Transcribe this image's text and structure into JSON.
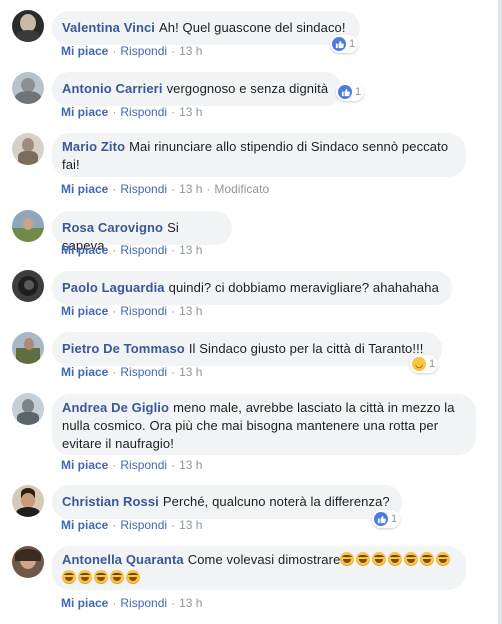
{
  "comments": [
    {
      "author": "Valentina Vinci",
      "text": "Ah! Quel guascone del sindaco!",
      "like": "Mi piace",
      "reply": "Rispondi",
      "time": "13 h",
      "reaction": {
        "type": "like",
        "count": "1"
      }
    },
    {
      "author": "Antonio Carrieri",
      "text": "vergognoso e senza dignità",
      "like": "Mi piace",
      "reply": "Rispondi",
      "time": "13 h",
      "reaction": {
        "type": "like",
        "count": "1"
      }
    },
    {
      "author": "Mario Zito",
      "text": "Mai rinunciare allo stipendio di Sindaco sennò peccato fai!",
      "like": "Mi piace",
      "reply": "Rispondi",
      "time": "13 h",
      "edited": "Modificato"
    },
    {
      "author": "Rosa Carovigno",
      "text": "Si sapeva",
      "like": "Mi piace",
      "reply": "Rispondi",
      "time": "13 h"
    },
    {
      "author": "Paolo Laguardia",
      "text": "quindi? ci dobbiamo meravigliare? ahahahaha",
      "like": "Mi piace",
      "reply": "Rispondi",
      "time": "13 h"
    },
    {
      "author": "Pietro De Tommaso",
      "text": "Il Sindaco giusto per la città di Taranto!!!",
      "like": "Mi piace",
      "reply": "Rispondi",
      "time": "13 h",
      "reaction": {
        "type": "haha",
        "count": "1"
      }
    },
    {
      "author": "Andrea De Giglio",
      "text": "meno male, avrebbe lasciato la città in mezzo la nulla cosmico. Ora più che mai bisogna mantenere una rotta per evitare il naufragio!",
      "like": "Mi piace",
      "reply": "Rispondi",
      "time": "13 h"
    },
    {
      "author": "Christian Rossi",
      "text": "Perché, qualcuno noterà la differenza?",
      "like": "Mi piace",
      "reply": "Rispondi",
      "time": "13 h",
      "reaction": {
        "type": "like",
        "count": "1"
      }
    },
    {
      "author": "Antonella Quaranta",
      "text": "Come volevasi dimostrare",
      "like": "Mi piace",
      "reply": "Rispondi",
      "time": "13 h",
      "emoji_count": 12,
      "emoji_icon": "rofl-emoji-icon"
    }
  ],
  "colors": {
    "author": "#385898",
    "link": "#4267b2",
    "bubble": "#f2f3f5",
    "meta": "#90949c"
  }
}
